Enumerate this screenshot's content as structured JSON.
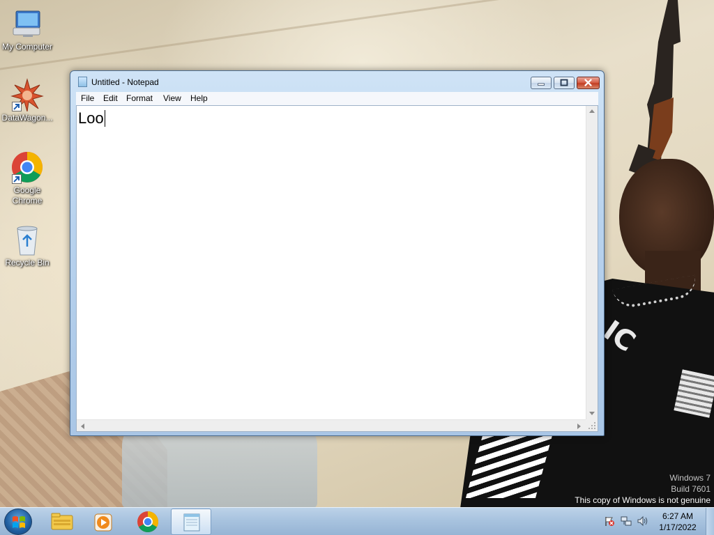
{
  "desktop": {
    "icons": [
      {
        "label": "My Computer",
        "icon": "computer-icon"
      },
      {
        "label": "DataWagon...",
        "icon": "datawagon-icon"
      },
      {
        "label": "Google Chrome",
        "icon": "chrome-icon"
      },
      {
        "label": "Recycle Bin",
        "icon": "recycle-bin-icon"
      }
    ]
  },
  "window": {
    "title": "Untitled - Notepad",
    "menu": [
      "File",
      "Edit",
      "Format",
      "View",
      "Help"
    ],
    "content": "Loo"
  },
  "watermark": {
    "line1": "Windows 7",
    "line2": "Build 7601",
    "line3": "This copy of Windows is not genuine"
  },
  "taskbar": {
    "pinned": [
      "windows-explorer-icon",
      "media-player-icon",
      "chrome-icon",
      "notepad-icon"
    ],
    "active": "notepad-icon",
    "tray": [
      "action-center-flag-icon",
      "network-icon",
      "volume-icon"
    ],
    "time": "6:27 AM",
    "date": "1/17/2022"
  },
  "colors": {
    "taskbar": "#a8c3df",
    "window_frame": "#b9d3ee",
    "close_button": "#c23d22"
  }
}
